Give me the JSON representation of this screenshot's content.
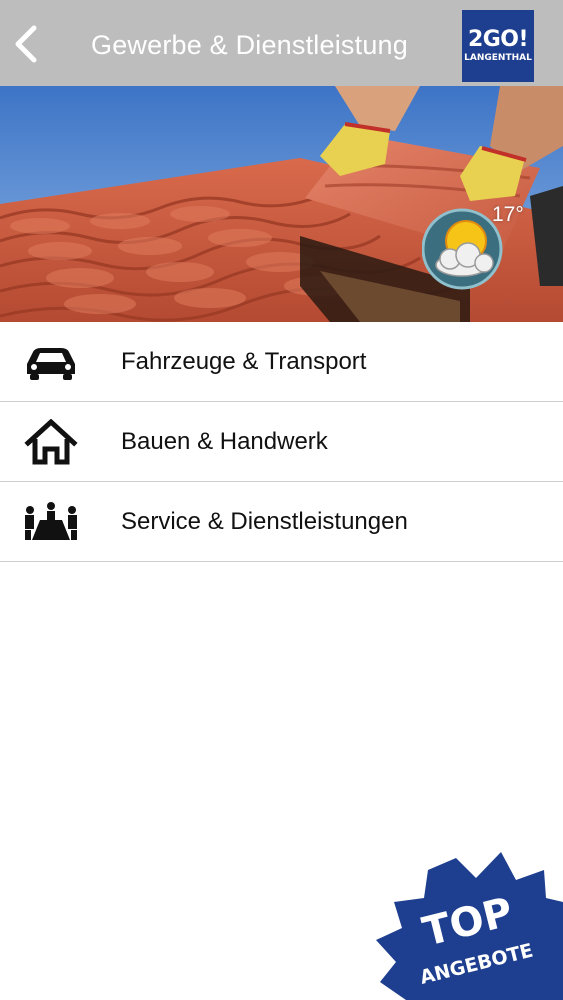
{
  "header": {
    "title": "Gewerbe & Dienstleistung",
    "back_icon": "chevron-left-icon",
    "logo": {
      "main": "2GO!",
      "sub": "LANGENTHAL"
    },
    "color": "#bdbdbd",
    "logo_color": "#1e3f8f"
  },
  "weather": {
    "temperature": "17°",
    "icon": "sun-behind-cloud-icon"
  },
  "categories": [
    {
      "label": "Fahrzeuge & Transport",
      "icon": "car-icon"
    },
    {
      "label": "Bauen & Handwerk",
      "icon": "house-icon"
    },
    {
      "label": "Service & Dienstleistungen",
      "icon": "meeting-table-icon"
    }
  ],
  "promo": {
    "line1": "TOP",
    "line2": "ANGEBOTE",
    "color": "#1e3f8f"
  }
}
